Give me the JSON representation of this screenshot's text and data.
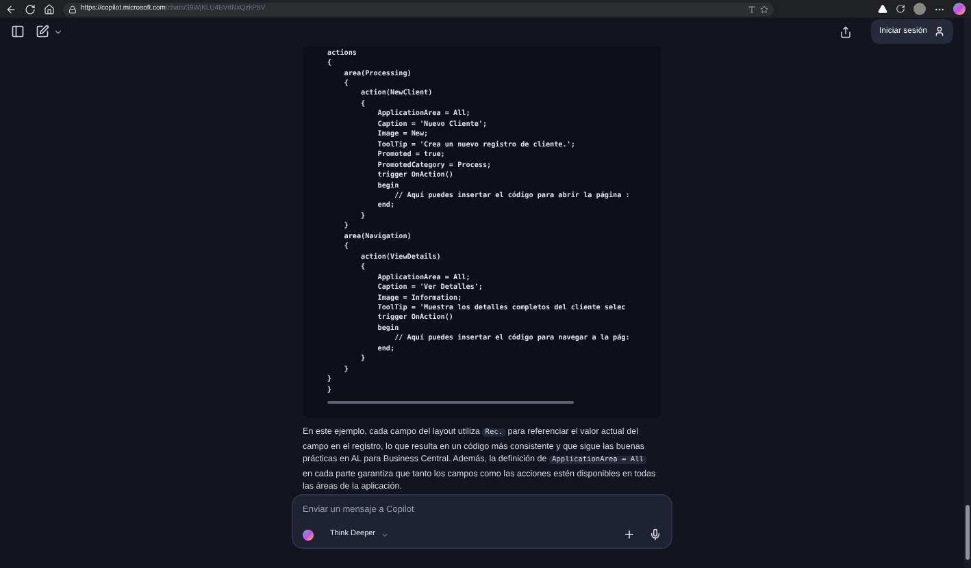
{
  "browser": {
    "url_host": "https://copilot.microsoft.com",
    "url_path": "/chats/39WjKLU4BVrtNxQzkP5V"
  },
  "header": {
    "sign_in": "Iniciar sesión"
  },
  "code_lines": [
    "actions",
    "{",
    "    area(Processing)",
    "    {",
    "        action(NewClient)",
    "        {",
    "            ApplicationArea = All;",
    "            Caption = 'Nuevo Cliente';",
    "            Image = New;",
    "            ToolTip = 'Crea un nuevo registro de cliente.';",
    "            Promoted = true;",
    "            PromotedCategory = Process;",
    "            trigger OnAction()",
    "            begin",
    "                // Aquí puedes insertar el código para abrir la página :",
    "            end;",
    "        }",
    "    }",
    "    area(Navigation)",
    "    {",
    "        action(ViewDetails)",
    "        {",
    "            ApplicationArea = All;",
    "            Caption = 'Ver Detalles';",
    "            Image = Information;",
    "            ToolTip = 'Muestra los detalles completos del cliente selec",
    "            trigger OnAction()",
    "            begin",
    "                // Aquí puedes insertar el código para navegar a la pág:",
    "            end;",
    "        }",
    "    }",
    "}",
    "}"
  ],
  "paragraph": [
    {
      "kind": "text",
      "text": "En este ejemplo, cada campo del layout utiliza "
    },
    {
      "kind": "code",
      "text": "Rec."
    },
    {
      "kind": "text",
      "text": " para referenciar el valor actual del campo en el registro, lo que resulta en un código más consistente y que sigue las buenas prácticas en AL para Business Central. Además, la definición de "
    },
    {
      "kind": "code",
      "text": "ApplicationArea = All"
    },
    {
      "kind": "text",
      "text": " en cada parte garantiza que tanto los campos como las acciones estén disponibles en todas las áreas de la aplicación."
    }
  ],
  "composer": {
    "placeholder": "Enviar un mensaje a Copilot",
    "mode": "Think Deeper"
  }
}
